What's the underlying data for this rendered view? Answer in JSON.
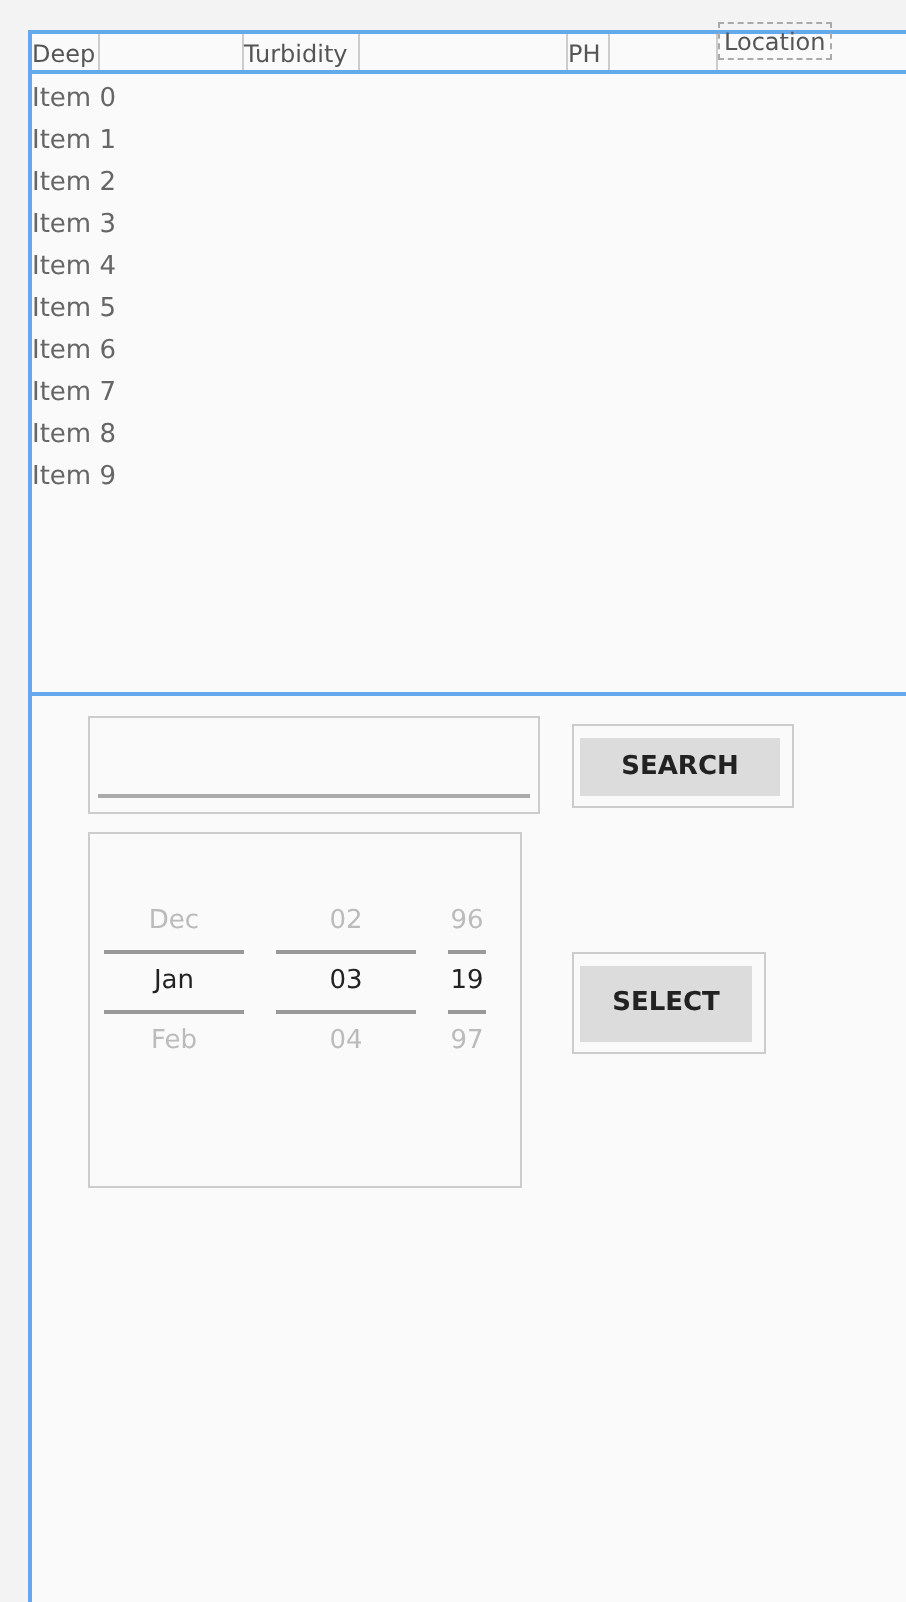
{
  "table": {
    "columns": [
      {
        "label": "Deep",
        "kind": "label"
      },
      {
        "kind": "spacer"
      },
      {
        "label": "Turbidity",
        "kind": "label"
      },
      {
        "kind": "spacer"
      },
      {
        "label": "PH",
        "kind": "label"
      },
      {
        "kind": "spacer"
      },
      {
        "label": "Location",
        "kind": "dashed"
      }
    ],
    "rows": [
      "Item 0",
      "Item 1",
      "Item 2",
      "Item 3",
      "Item 4",
      "Item 5",
      "Item 6",
      "Item 7",
      "Item 8",
      "Item 9"
    ]
  },
  "search": {
    "button": "SEARCH"
  },
  "date_picker": {
    "columns": [
      {
        "kind": "month",
        "options": [
          {
            "label": "Dec",
            "selected": false
          },
          {
            "label": "Jan",
            "selected": true
          },
          {
            "label": "Feb",
            "selected": false
          }
        ]
      },
      {
        "kind": "day",
        "options": [
          {
            "label": "02",
            "selected": false
          },
          {
            "label": "03",
            "selected": true
          },
          {
            "label": "04",
            "selected": false
          }
        ]
      },
      {
        "kind": "year",
        "options": [
          {
            "label": "96",
            "selected": false
          },
          {
            "label": "19",
            "selected": true
          },
          {
            "label": "97",
            "selected": false
          }
        ]
      }
    ]
  },
  "select_button": "SELECT"
}
